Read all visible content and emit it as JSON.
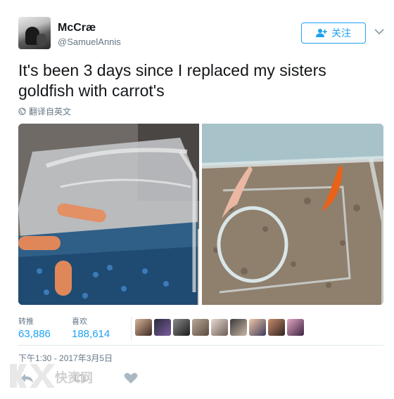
{
  "user": {
    "name": "McCræ",
    "handle": "@SamuelAnnis"
  },
  "follow_button": {
    "label": "关注",
    "icon": "add-user-icon"
  },
  "tweet": {
    "text": "It's been 3 days since I replaced my sisters goldfish with carrot's",
    "translate_label": "翻译自英文"
  },
  "stats": {
    "retweets_label": "转推",
    "retweets_count": "63,886",
    "likes_label": "喜欢",
    "likes_count": "188,614"
  },
  "timestamp": "下午1:30 - 2017年3月5日",
  "actions": [
    "reply-icon",
    "retweet-icon",
    "heart-icon"
  ],
  "watermark": "快资网",
  "colors": {
    "accent": "#1da1f2",
    "muted": "#657786",
    "text": "#14171a",
    "border": "#e1e8ed"
  }
}
